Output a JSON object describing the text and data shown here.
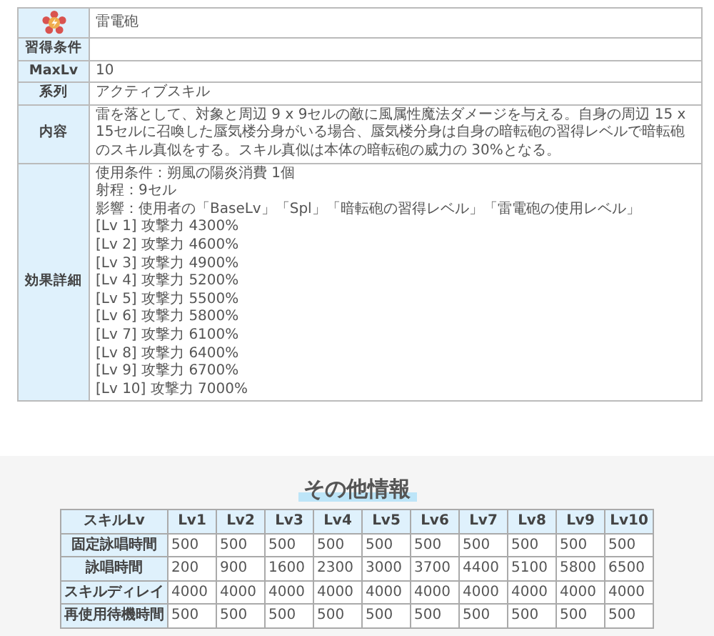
{
  "skill": {
    "name": "雷電砲"
  },
  "attributes": [
    {
      "label": "習得条件"
    },
    {
      "label": "MaxLv",
      "value": "10"
    },
    {
      "label": "系列",
      "value": "アクティブスキル"
    },
    {
      "label": "内容",
      "value": "雷を落として、対象と周辺 9 x 9セルの敵に風属性魔法ダメージを与える。自身の周辺 15 x 15セルに召喚した蜃気楼分身がいる場合、蜃気楼分身は自身の暗転砲の習得レベルで暗転砲のスキル真似をする。スキル真似は本体の暗転砲の威力の 30%となる。"
    }
  ],
  "effect": {
    "label": "効果詳細",
    "lines": [
      "使用条件：朔風の陽炎消費 1個",
      "射程：9セル",
      "影響：使用者の「BaseLv」「Spl」「暗転砲の習得レベル」「雷電砲の使用レベル」",
      "[Lv 1] 攻撃力 4300%",
      "[Lv 2] 攻撃力 4600%",
      "[Lv 3] 攻撃力 4900%",
      "[Lv 4] 攻撃力 5200%",
      "[Lv 5] 攻撃力 5500%",
      "[Lv 6] 攻撃力 5800%",
      "[Lv 7] 攻撃力 6100%",
      "[Lv 8] 攻撃力 6400%",
      "[Lv 9] 攻撃力 6700%",
      "[Lv 10] 攻撃力 7000%"
    ]
  },
  "other_info": {
    "heading": "その他情報",
    "columns": [
      "スキルLv",
      "Lv1",
      "Lv2",
      "Lv3",
      "Lv4",
      "Lv5",
      "Lv6",
      "Lv7",
      "Lv8",
      "Lv9",
      "Lv10"
    ],
    "rows": [
      {
        "label": "固定詠唱時間",
        "values": [
          "500",
          "500",
          "500",
          "500",
          "500",
          "500",
          "500",
          "500",
          "500",
          "500"
        ]
      },
      {
        "label": "詠唱時間",
        "values": [
          "200",
          "900",
          "1600",
          "2300",
          "3000",
          "3700",
          "4400",
          "5100",
          "5800",
          "6500"
        ]
      },
      {
        "label": "スキルディレイ",
        "values": [
          "4000",
          "4000",
          "4000",
          "4000",
          "4000",
          "4000",
          "4000",
          "4000",
          "4000",
          "4000"
        ]
      },
      {
        "label": "再使用待機時間",
        "values": [
          "500",
          "500",
          "500",
          "500",
          "500",
          "500",
          "500",
          "500",
          "500",
          "500"
        ]
      }
    ]
  }
}
